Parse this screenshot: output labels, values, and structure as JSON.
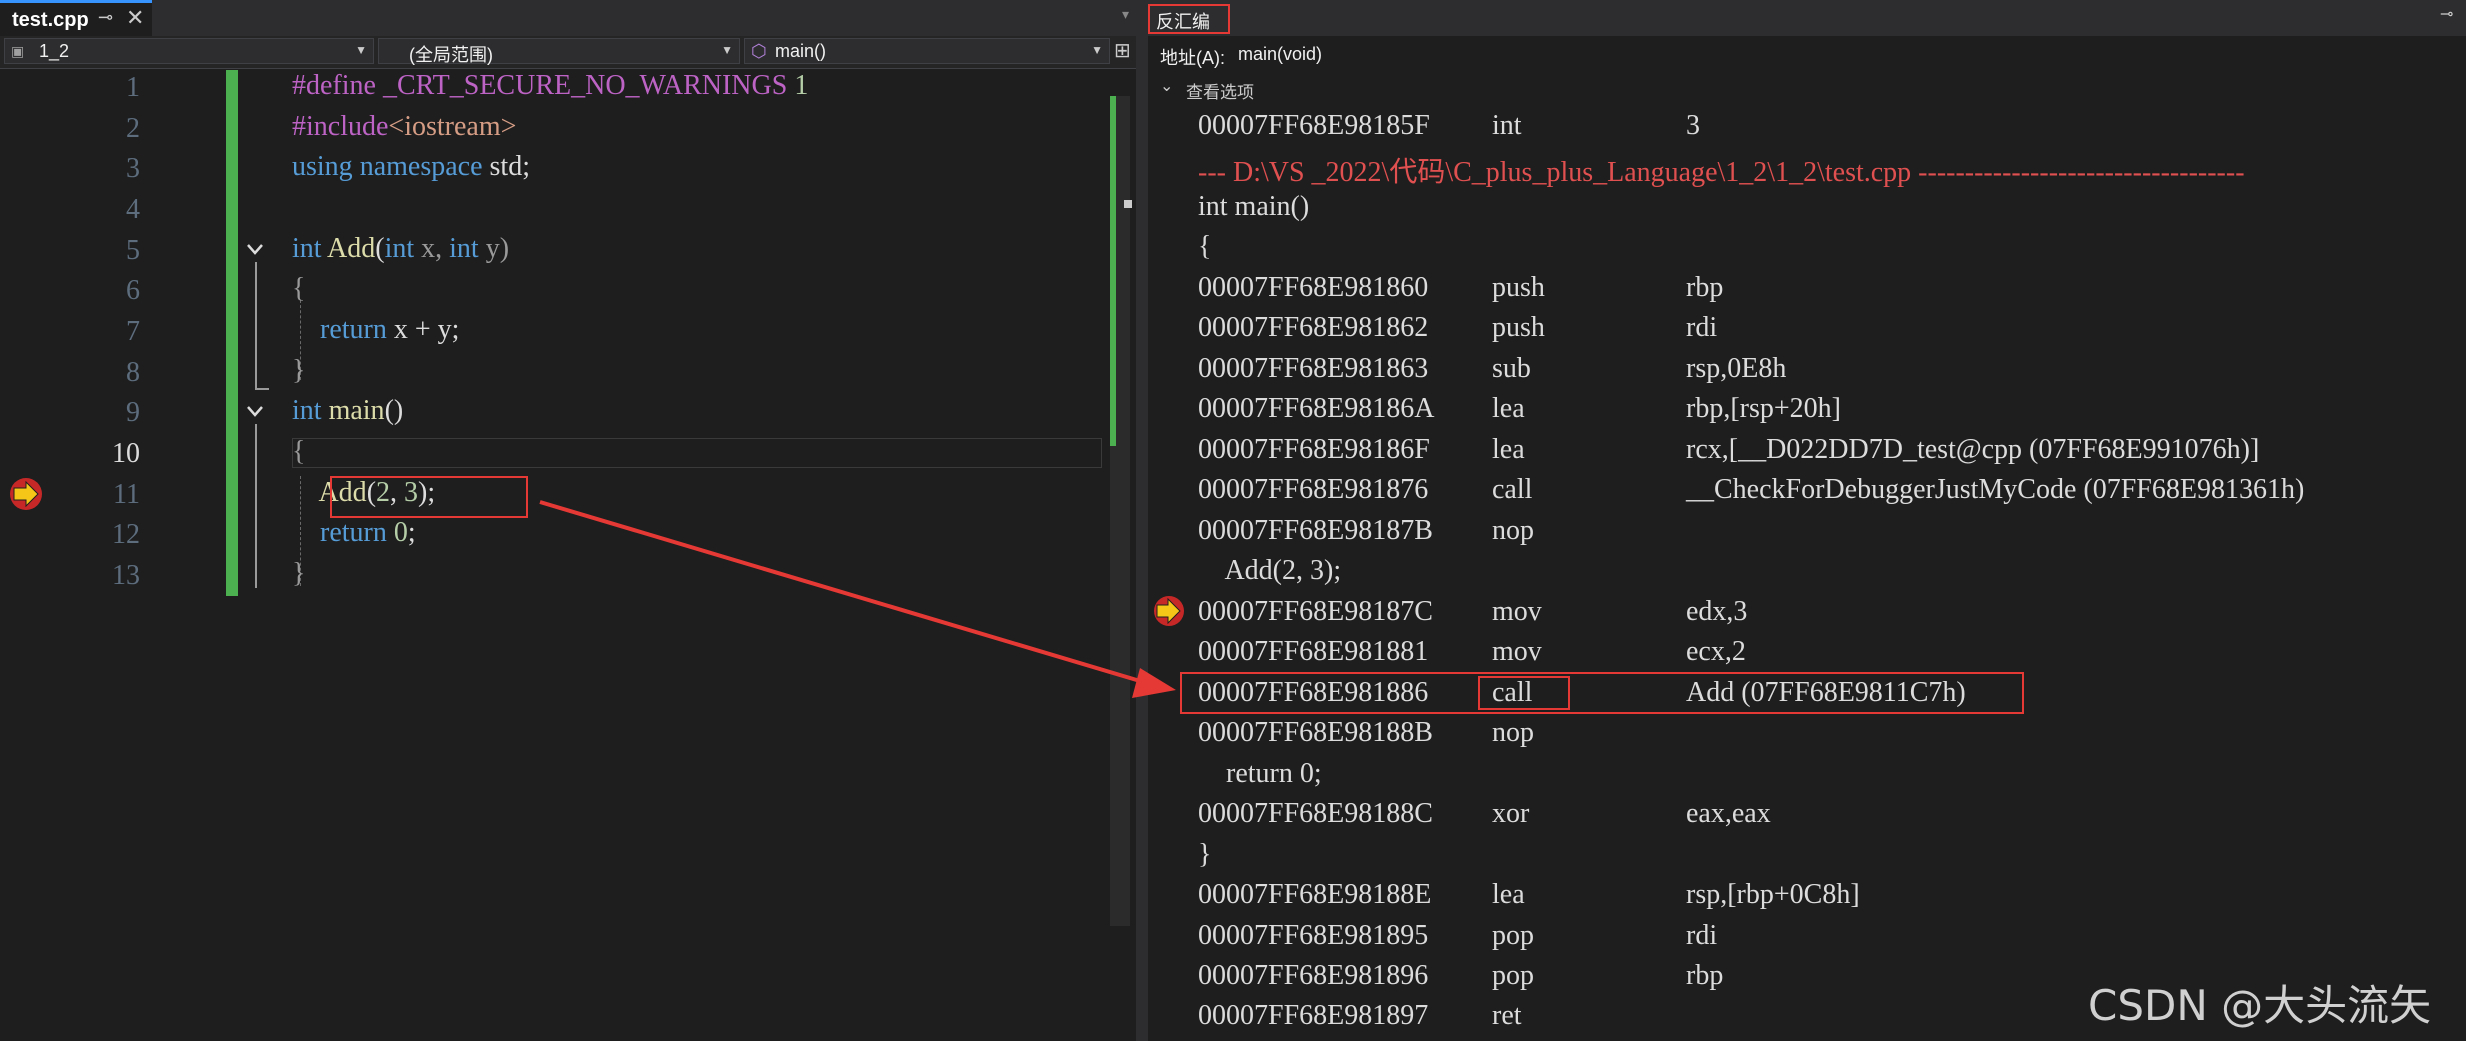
{
  "editor": {
    "tab_title": "test.cpp",
    "tab_pin": "⊸",
    "tab_close": "✕",
    "nav_project": "1_2",
    "nav_scope": "(全局范围)",
    "nav_function": "main()",
    "line_numbers": [
      "1",
      "2",
      "3",
      "4",
      "5",
      "6",
      "7",
      "8",
      "9",
      "10",
      "11",
      "12",
      "13"
    ],
    "code": {
      "l1a": "#define",
      "l1b": " _CRT_SECURE_NO_WARNINGS ",
      "l1c": "1",
      "l2a": "#include",
      "l2b": "<iostream>",
      "l3a": "using",
      "l3b": " namespace ",
      "l3c": "std;",
      "l5a": "int",
      "l5b": " Add",
      "l5c": "(",
      "l5d": "int",
      "l5e": " x, ",
      "l5f": "int",
      "l5g": " y)",
      "l6": "{",
      "l7a": "    return",
      "l7b": " x + y;",
      "l8": "}",
      "l9a": "int",
      "l9b": " main",
      "l9c": "()",
      "l10": "{",
      "l11a": "    Add",
      "l11b": "(",
      "l11c": "2",
      "l11d": ", ",
      "l11e": "3",
      "l11f": ");",
      "l12a": "    return",
      "l12b": " 0",
      "l12c": ";",
      "l13": "}"
    }
  },
  "disassembly": {
    "tab_label": "反汇编",
    "address_label": "地址(A):",
    "address_value": "main(void)",
    "view_options": "查看选项",
    "rows": [
      {
        "addr": "00007FF68E98185F",
        "mnem": "int",
        "op": "3"
      },
      {
        "src": "--- D:\\VS _2022\\代码\\C_plus_plus_Language\\1_2\\1_2\\test.cpp -----------------------------------"
      },
      {
        "code": "int main()"
      },
      {
        "code": "{"
      },
      {
        "addr": "00007FF68E981860",
        "mnem": "push",
        "op": "rbp"
      },
      {
        "addr": "00007FF68E981862",
        "mnem": "push",
        "op": "rdi"
      },
      {
        "addr": "00007FF68E981863",
        "mnem": "sub",
        "op": "rsp,0E8h"
      },
      {
        "addr": "00007FF68E98186A",
        "mnem": "lea",
        "op": "rbp,[rsp+20h]"
      },
      {
        "addr": "00007FF68E98186F",
        "mnem": "lea",
        "op": "rcx,[__D022DD7D_test@cpp (07FF68E991076h)]"
      },
      {
        "addr": "00007FF68E981876",
        "mnem": "call",
        "op": "__CheckForDebuggerJustMyCode (07FF68E981361h)"
      },
      {
        "addr": "00007FF68E98187B",
        "mnem": "nop",
        "op": ""
      },
      {
        "code": "    Add(2, 3);"
      },
      {
        "addr": "00007FF68E98187C",
        "mnem": "mov",
        "op": "edx,3"
      },
      {
        "addr": "00007FF68E981881",
        "mnem": "mov",
        "op": "ecx,2"
      },
      {
        "addr": "00007FF68E981886",
        "mnem": "call",
        "op": "Add (07FF68E9811C7h)"
      },
      {
        "addr": "00007FF68E98188B",
        "mnem": "nop",
        "op": ""
      },
      {
        "code": "    return 0;"
      },
      {
        "addr": "00007FF68E98188C",
        "mnem": "xor",
        "op": "eax,eax"
      },
      {
        "code": "}"
      },
      {
        "addr": "00007FF68E98188E",
        "mnem": "lea",
        "op": "rsp,[rbp+0C8h]"
      },
      {
        "addr": "00007FF68E981895",
        "mnem": "pop",
        "op": "rdi"
      },
      {
        "addr": "00007FF68E981896",
        "mnem": "pop",
        "op": "rbp"
      },
      {
        "addr": "00007FF68E981897",
        "mnem": "ret",
        "op": ""
      }
    ]
  },
  "watermark": "CSDN @大头流矢",
  "colors": {
    "highlight_box": "#e53935",
    "change_bar": "#4caf50",
    "source_line": "#e05050",
    "breakpoint_arrow": "#f5c518"
  }
}
